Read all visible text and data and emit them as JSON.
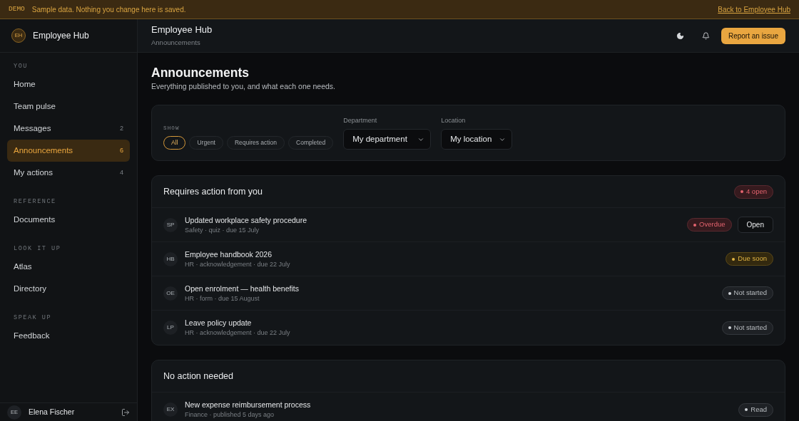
{
  "banner": {
    "tag": "DEMO",
    "message": "Sample data. Nothing you change here is saved.",
    "link": "Back to Employee Hub"
  },
  "sidebar": {
    "brand": {
      "initials": "EH",
      "name": "Employee Hub"
    },
    "sections": [
      {
        "label": "YOU",
        "items": [
          {
            "label": "Home",
            "selected": false
          },
          {
            "label": "Team pulse",
            "selected": false
          },
          {
            "label": "Messages",
            "count": "2",
            "selected": false
          },
          {
            "label": "Announcements",
            "count": "6",
            "selected": true
          },
          {
            "label": "My actions",
            "count": "4",
            "selected": false
          }
        ]
      },
      {
        "label": "REFERENCE",
        "items": [
          {
            "label": "Documents",
            "selected": false
          }
        ]
      },
      {
        "label": "LOOK IT UP",
        "items": [
          {
            "label": "Atlas",
            "selected": false
          },
          {
            "label": "Directory",
            "selected": false
          }
        ]
      },
      {
        "label": "SPEAK UP",
        "items": [
          {
            "label": "Feedback",
            "selected": false
          }
        ]
      }
    ],
    "user": {
      "initials": "EE",
      "name": "Elena Fischer"
    }
  },
  "header": {
    "title": "Employee Hub",
    "breadcrumb": "Announcements",
    "button": "Report an issue"
  },
  "page": {
    "title": "Announcements",
    "subtitle": "Everything published to you, and what each one needs."
  },
  "filters": {
    "show_label": "SHOW",
    "chips": [
      {
        "label": "All",
        "selected": true
      },
      {
        "label": "Urgent",
        "selected": false
      },
      {
        "label": "Requires action",
        "selected": false
      },
      {
        "label": "Completed",
        "selected": false
      }
    ],
    "selects": [
      {
        "label": "Department",
        "value": "My department"
      },
      {
        "label": "Location",
        "value": "My location"
      }
    ]
  },
  "sections": [
    {
      "title": "Requires action from you",
      "badge": {
        "label": "4 open",
        "kind": "danger"
      },
      "rows": [
        {
          "initials": "SP",
          "title": "Updated workplace safety procedure",
          "meta": "Safety · quiz · due 15 July",
          "status": {
            "label": "Overdue",
            "kind": "danger"
          },
          "action": "Open"
        },
        {
          "initials": "HB",
          "title": "Employee handbook 2026",
          "meta": "HR · acknowledgement · due 22 July",
          "status": {
            "label": "Due soon",
            "kind": "warning"
          }
        },
        {
          "initials": "OE",
          "title": "Open enrolment — health benefits",
          "meta": "HR · form · due 15 August",
          "status": {
            "label": "Not started",
            "kind": "neutral"
          }
        },
        {
          "initials": "LP",
          "title": "Leave policy update",
          "meta": "HR · acknowledgement · due 22 July",
          "status": {
            "label": "Not started",
            "kind": "neutral"
          }
        }
      ]
    },
    {
      "title": "No action needed",
      "rows": [
        {
          "initials": "EX",
          "title": "New expense reimbursement process",
          "meta": "Finance · published 5 days ago",
          "status": {
            "label": "Read",
            "kind": "neutral"
          }
        }
      ]
    }
  ]
}
